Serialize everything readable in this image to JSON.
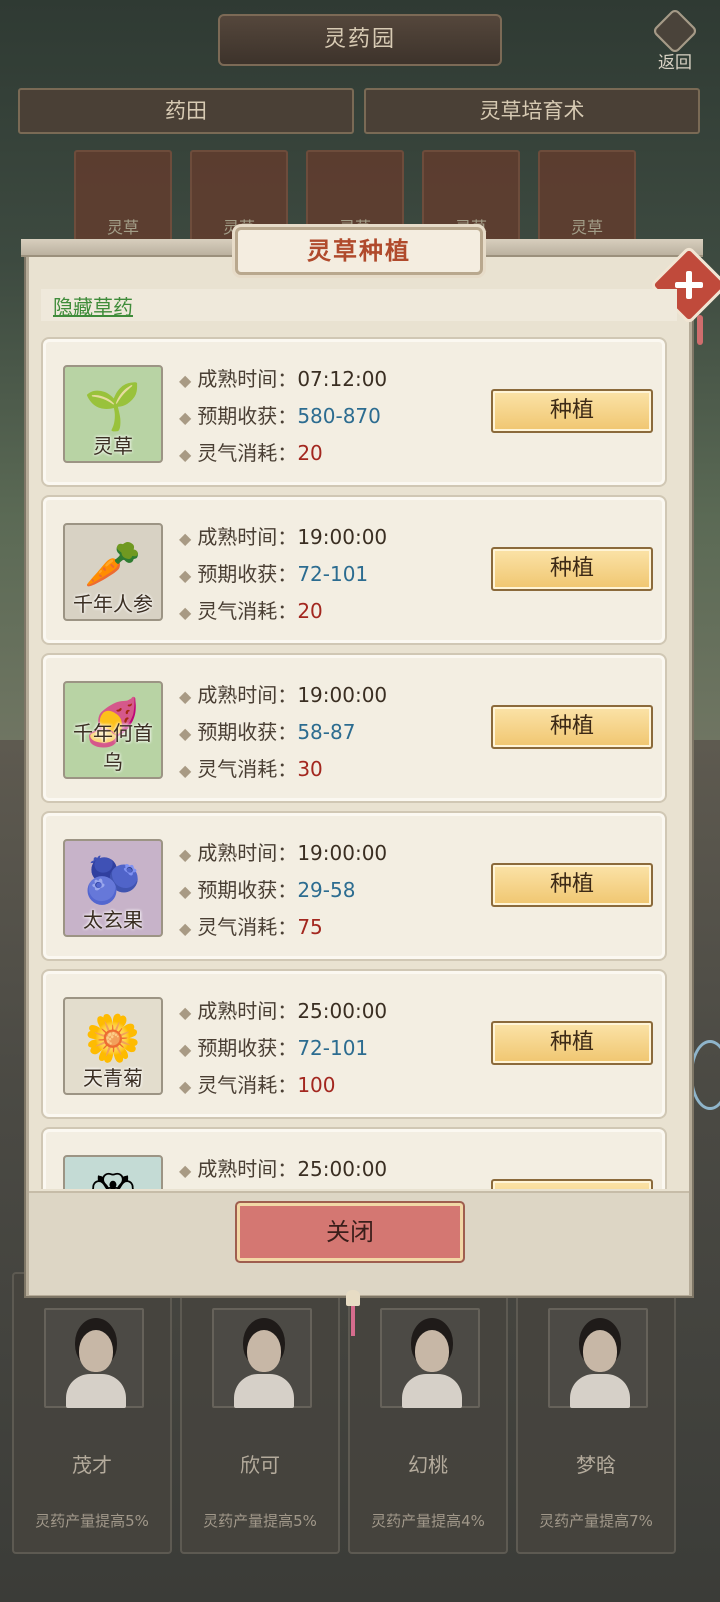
{
  "header": {
    "title": "灵药园",
    "back_label": "返回",
    "tabs": [
      "药田",
      "灵草培育术"
    ],
    "field_labels": [
      "灵草",
      "灵草",
      "灵草",
      "灵草",
      "灵草"
    ]
  },
  "modal": {
    "title": "灵草种植",
    "hidden_link": "隐藏草药",
    "close_label": "关闭",
    "plants": [
      {
        "name": "灵草",
        "icon": "sprout-icon",
        "time_label": "成熟时间：",
        "time": "07:12:00",
        "yield_label": "预期收获：",
        "yield": "580-870",
        "cost_label": "灵气消耗：",
        "cost": "20",
        "button": "种植"
      },
      {
        "name": "千年人参",
        "icon": "ginseng-icon",
        "time_label": "成熟时间：",
        "time": "19:00:00",
        "yield_label": "预期收获：",
        "yield": "72-101",
        "cost_label": "灵气消耗：",
        "cost": "20",
        "button": "种植"
      },
      {
        "name": "千年何首乌",
        "icon": "fleeceflower-icon",
        "time_label": "成熟时间：",
        "time": "19:00:00",
        "yield_label": "预期收获：",
        "yield": "58-87",
        "cost_label": "灵气消耗：",
        "cost": "30",
        "button": "种植"
      },
      {
        "name": "太玄果",
        "icon": "fruit-branch-icon",
        "time_label": "成熟时间：",
        "time": "19:00:00",
        "yield_label": "预期收获：",
        "yield": "29-58",
        "cost_label": "灵气消耗：",
        "cost": "75",
        "button": "种植"
      },
      {
        "name": "天青菊",
        "icon": "chrysanthemum-icon",
        "time_label": "成熟时间：",
        "time": "25:00:00",
        "yield_label": "预期收获：",
        "yield": "72-101",
        "cost_label": "灵气消耗：",
        "cost": "100",
        "button": "种植"
      },
      {
        "name": "",
        "icon": "white-flower-icon",
        "time_label": "成熟时间：",
        "time": "25:00:00",
        "yield_label": "",
        "yield": "",
        "cost_label": "",
        "cost": "",
        "button": ""
      }
    ]
  },
  "helpers": [
    {
      "name": "茂才",
      "bonus": "灵药产量提高5%"
    },
    {
      "name": "欣可",
      "bonus": "灵药产量提高5%"
    },
    {
      "name": "幻桃",
      "bonus": "灵药产量提高4%"
    },
    {
      "name": "梦晗",
      "bonus": "灵药产量提高7%"
    }
  ],
  "colors": {
    "yield": "#2c6c90",
    "cost": "#a3271f",
    "title": "#b04a2c",
    "link": "#3f8c3a",
    "plant_button": "#f0c670",
    "close_button": "#d47772"
  }
}
